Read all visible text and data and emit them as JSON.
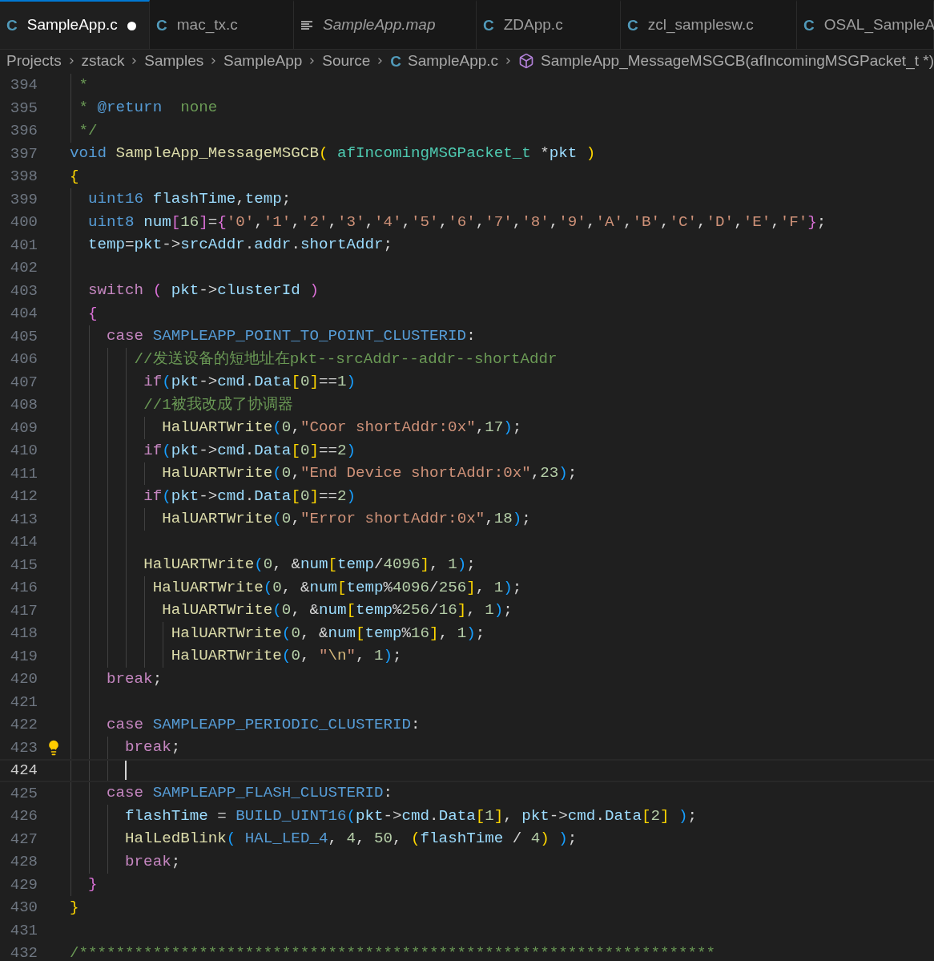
{
  "tabs": [
    {
      "label": "SampleApp.c",
      "kind": "c",
      "glyph": "C",
      "selected": true,
      "modified": true,
      "preview": false
    },
    {
      "label": "mac_tx.c",
      "kind": "c",
      "glyph": "C",
      "selected": false,
      "modified": false,
      "preview": false
    },
    {
      "label": "SampleApp.map",
      "kind": "text",
      "selected": false,
      "modified": false,
      "preview": true
    },
    {
      "label": "ZDApp.c",
      "kind": "c",
      "glyph": "C",
      "selected": false,
      "modified": false,
      "preview": false
    },
    {
      "label": "zcl_samplesw.c",
      "kind": "c",
      "glyph": "C",
      "selected": false,
      "modified": false,
      "preview": false
    },
    {
      "label": "OSAL_SampleA",
      "kind": "c",
      "glyph": "C",
      "selected": false,
      "modified": false,
      "preview": false
    }
  ],
  "breadcrumb": [
    {
      "label": "Projects",
      "kind": "folder"
    },
    {
      "label": "zstack",
      "kind": "folder"
    },
    {
      "label": "Samples",
      "kind": "folder"
    },
    {
      "label": "SampleApp",
      "kind": "folder"
    },
    {
      "label": "Source",
      "kind": "folder"
    },
    {
      "label": "SampleApp.c",
      "kind": "c",
      "glyph": "C"
    },
    {
      "label": "SampleApp_MessageMSGCB(afIncomingMSGPacket_t *)",
      "kind": "symbol"
    }
  ],
  "lines": [
    {
      "number": "394",
      "current": false,
      "lightbulb": false,
      "text": " *"
    },
    {
      "number": "395",
      "current": false,
      "lightbulb": false,
      "text": " * @return  none"
    },
    {
      "number": "396",
      "current": false,
      "lightbulb": false,
      "text": " */"
    },
    {
      "number": "397",
      "current": false,
      "lightbulb": false,
      "text": "void SampleApp_MessageMSGCB( afIncomingMSGPacket_t *pkt )"
    },
    {
      "number": "398",
      "current": false,
      "lightbulb": false,
      "text": "{"
    },
    {
      "number": "399",
      "current": false,
      "lightbulb": false,
      "text": "  uint16 flashTime,temp;"
    },
    {
      "number": "400",
      "current": false,
      "lightbulb": false,
      "text": "  uint8 num[16]={'0','1','2','3','4','5','6','7','8','9','A','B','C','D','E','F'};"
    },
    {
      "number": "401",
      "current": false,
      "lightbulb": false,
      "text": "  temp=pkt->srcAddr.addr.shortAddr;"
    },
    {
      "number": "402",
      "current": false,
      "lightbulb": false
    },
    {
      "number": "403",
      "current": false,
      "lightbulb": false,
      "text": "  switch ( pkt->clusterId )"
    },
    {
      "number": "404",
      "current": false,
      "lightbulb": false,
      "text": "  {"
    },
    {
      "number": "405",
      "current": false,
      "lightbulb": false,
      "text": "    case SAMPLEAPP_POINT_TO_POINT_CLUSTERID:"
    },
    {
      "number": "406",
      "current": false,
      "lightbulb": false,
      "text": "       //发送设备的短地址在pkt--srcAddr--addr--shortAddr"
    },
    {
      "number": "407",
      "current": false,
      "lightbulb": false,
      "text": "        if(pkt->cmd.Data[0]==1)"
    },
    {
      "number": "408",
      "current": false,
      "lightbulb": false,
      "text": "        //1被我改成了协调器"
    },
    {
      "number": "409",
      "current": false,
      "lightbulb": false,
      "text": "          HalUARTWrite(0,\"Coor shortAddr:0x\",17);"
    },
    {
      "number": "410",
      "current": false,
      "lightbulb": false,
      "text": "        if(pkt->cmd.Data[0]==2)"
    },
    {
      "number": "411",
      "current": false,
      "lightbulb": false,
      "text": "          HalUARTWrite(0,\"End Device shortAddr:0x\",23);"
    },
    {
      "number": "412",
      "current": false,
      "lightbulb": false,
      "text": "        if(pkt->cmd.Data[0]==2)"
    },
    {
      "number": "413",
      "current": false,
      "lightbulb": false,
      "text": "          HalUARTWrite(0,\"Error shortAddr:0x\",18);"
    },
    {
      "number": "414",
      "current": false,
      "lightbulb": false
    },
    {
      "number": "415",
      "current": false,
      "lightbulb": false,
      "text": "        HalUARTWrite(0, &num[temp/4096], 1);"
    },
    {
      "number": "416",
      "current": false,
      "lightbulb": false,
      "text": "         HalUARTWrite(0, &num[temp%4096/256], 1);"
    },
    {
      "number": "417",
      "current": false,
      "lightbulb": false,
      "text": "          HalUARTWrite(0, &num[temp%256/16], 1);"
    },
    {
      "number": "418",
      "current": false,
      "lightbulb": false,
      "text": "           HalUARTWrite(0, &num[temp%16], 1);"
    },
    {
      "number": "419",
      "current": false,
      "lightbulb": false,
      "text": "           HalUARTWrite(0, \"\\n\", 1);"
    },
    {
      "number": "420",
      "current": false,
      "lightbulb": false,
      "text": "    break;"
    },
    {
      "number": "421",
      "current": false,
      "lightbulb": false
    },
    {
      "number": "422",
      "current": false,
      "lightbulb": false,
      "text": "    case SAMPLEAPP_PERIODIC_CLUSTERID:"
    },
    {
      "number": "423",
      "current": false,
      "lightbulb": true,
      "text": "      break;"
    },
    {
      "number": "424",
      "current": true,
      "lightbulb": false
    },
    {
      "number": "425",
      "current": false,
      "lightbulb": false,
      "text": "    case SAMPLEAPP_FLASH_CLUSTERID:"
    },
    {
      "number": "426",
      "current": false,
      "lightbulb": false,
      "text": "      flashTime = BUILD_UINT16(pkt->cmd.Data[1], pkt->cmd.Data[2] );"
    },
    {
      "number": "427",
      "current": false,
      "lightbulb": false,
      "text": "      HalLedBlink( HAL_LED_4, 4, 50, (flashTime / 4) );"
    },
    {
      "number": "428",
      "current": false,
      "lightbulb": false,
      "text": "      break;"
    },
    {
      "number": "429",
      "current": false,
      "lightbulb": false,
      "text": "  }"
    },
    {
      "number": "430",
      "current": false,
      "lightbulb": false,
      "text": "}"
    },
    {
      "number": "431",
      "current": false,
      "lightbulb": false
    },
    {
      "number": "432",
      "current": false,
      "lightbulb": false,
      "text": "/*********************************************************************"
    }
  ]
}
